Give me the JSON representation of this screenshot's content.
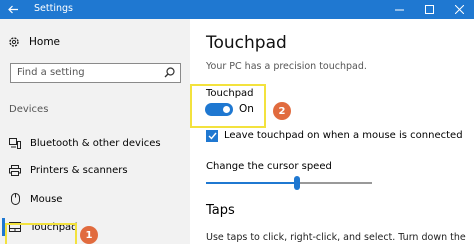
{
  "window": {
    "title": "Settings",
    "back_icon": "back-arrow-icon",
    "controls": [
      "minimize-icon",
      "maximize-icon",
      "close-icon"
    ]
  },
  "sidebar": {
    "home_label": "Home",
    "search_placeholder": "Find a setting",
    "section_label": "Devices",
    "items": [
      {
        "label": "Bluetooth & other devices",
        "icon": "bluetooth-devices-icon"
      },
      {
        "label": "Printers & scanners",
        "icon": "printer-icon"
      },
      {
        "label": "Mouse",
        "icon": "mouse-icon"
      },
      {
        "label": "Touchpad",
        "icon": "touchpad-icon",
        "selected": true
      }
    ]
  },
  "main": {
    "title": "Touchpad",
    "subtitle": "Your PC has a precision touchpad.",
    "touchpad_toggle_label": "Touchpad",
    "touchpad_toggle_state": "On",
    "leave_on_label": "Leave touchpad on when a mouse is connected",
    "leave_on_checked": true,
    "cursor_speed_label": "Change the cursor speed",
    "cursor_speed_fraction": 0.55,
    "taps_heading": "Taps",
    "taps_description": "Use taps to click, right-click, and select. Turn down the"
  },
  "annotations": {
    "badge1": "1",
    "badge2": "2"
  },
  "colors": {
    "accent": "#1f78d1",
    "highlight": "#f3e23d",
    "badge": "#e16b3e",
    "sidebar_bg": "#f2f2f2"
  }
}
